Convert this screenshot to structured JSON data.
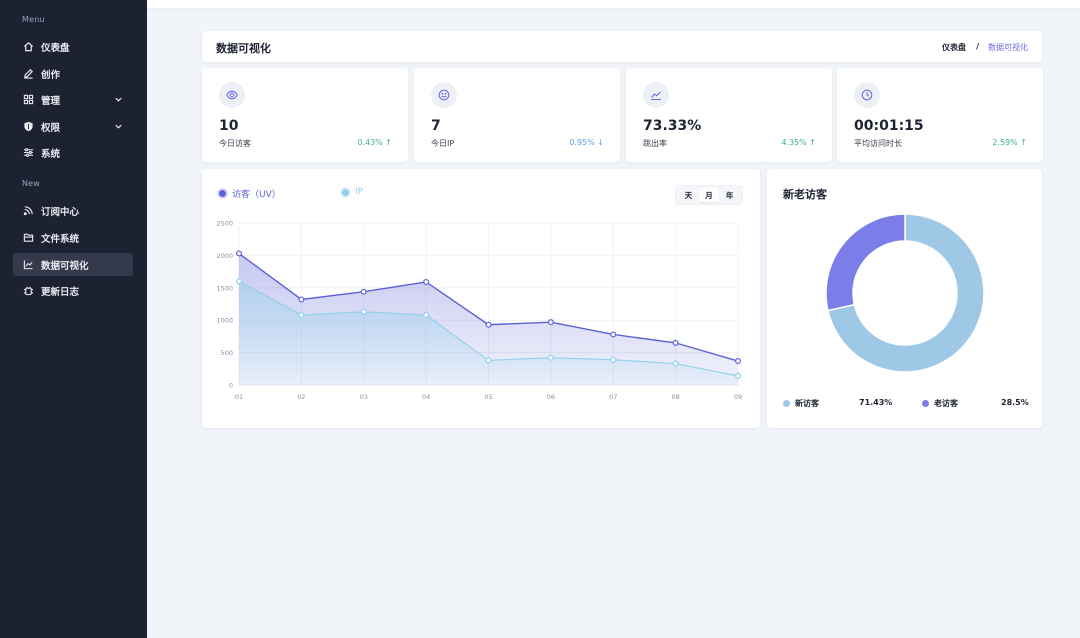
{
  "sidebar": {
    "headings": [
      "Menu",
      "New"
    ],
    "items": [
      {
        "label": "仪表盘",
        "icon": "home-icon"
      },
      {
        "label": "创作",
        "icon": "edit-icon"
      },
      {
        "label": "管理",
        "icon": "grid-icon",
        "expandable": true
      },
      {
        "label": "权限",
        "icon": "shield-icon",
        "expandable": true
      },
      {
        "label": "系统",
        "icon": "sliders-icon"
      },
      {
        "label": "订阅中心",
        "icon": "rss-icon"
      },
      {
        "label": "文件系统",
        "icon": "folder-icon"
      },
      {
        "label": "数据可视化",
        "icon": "line-chart-icon",
        "active": true
      },
      {
        "label": "更新日志",
        "icon": "bug-icon"
      }
    ]
  },
  "header": {
    "title": "数据可视化",
    "breadcrumb": {
      "home": "仪表盘",
      "separator": "/",
      "current": "数据可视化"
    }
  },
  "stats": [
    {
      "value": "10",
      "label": "今日访客",
      "trend": "0.43% ↑",
      "direction": "up",
      "icon": "eye-icon"
    },
    {
      "value": "7",
      "label": "今日IP",
      "trend": "0.95% ↓",
      "direction": "down",
      "icon": "smile-icon"
    },
    {
      "value": "73.33%",
      "label": "跳出率",
      "trend": "4.35% ↑",
      "direction": "up",
      "icon": "trend-icon"
    },
    {
      "value": "00:01:15",
      "label": "平均访问时长",
      "trend": "2.59% ↑",
      "direction": "up",
      "icon": "clock-icon"
    }
  ],
  "colors": {
    "accent": "#6c6be0",
    "uv": "#5c62d6",
    "ip": "#8fd0ea",
    "new_visitor": "#9ec8e6",
    "old_visitor": "#7b7ee8",
    "up": "#3db37c",
    "down": "#5a9ee8"
  },
  "line_chart": {
    "segmented": [
      "天",
      "月",
      "年"
    ],
    "selected": "月"
  },
  "donut": {
    "title": "新老访客"
  },
  "chart_data": [
    {
      "type": "area",
      "categories": [
        "01",
        "02",
        "03",
        "04",
        "05",
        "06",
        "07",
        "08",
        "09"
      ],
      "series": [
        {
          "name": "访客（UV）",
          "values": [
            2030,
            1320,
            1440,
            1590,
            930,
            970,
            780,
            650,
            370
          ]
        },
        {
          "name": "IP",
          "values": [
            1600,
            1080,
            1130,
            1080,
            380,
            420,
            390,
            330,
            140
          ]
        }
      ],
      "yticks": [
        "2500",
        "2000",
        "1500",
        "1000",
        "500",
        "0"
      ],
      "ylim": [
        0,
        2500
      ],
      "grid": true,
      "legend": "top-left"
    },
    {
      "type": "pie",
      "labels": [
        "新访客",
        "老访客"
      ],
      "values": [
        71.43,
        28.57
      ],
      "display": [
        "71.43%",
        "28.5%"
      ],
      "legend": "bottom"
    }
  ]
}
